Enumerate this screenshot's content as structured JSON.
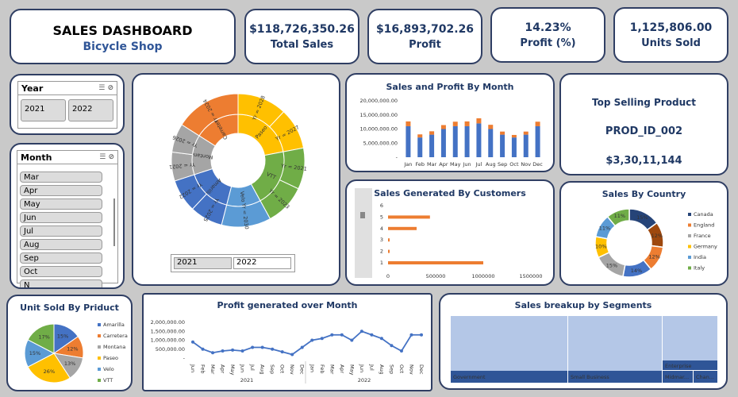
{
  "header": {
    "title": "SALES DASHBOARD",
    "subtitle": "Bicycle Shop"
  },
  "kpis": [
    {
      "value": "$118,726,350.26",
      "label": "Total Sales"
    },
    {
      "value": "$16,893,702.26",
      "label": "Profit"
    },
    {
      "value": "14.23%",
      "label": "Profit (%)"
    },
    {
      "value": "1,125,806.00",
      "label": "Units Sold"
    }
  ],
  "year_slicer": {
    "title": "Year",
    "items": [
      "2021",
      "2022"
    ]
  },
  "month_slicer": {
    "title": "Month",
    "items": [
      "Mar",
      "Apr",
      "May",
      "Jun",
      "Jul",
      "Aug",
      "Sep",
      "Oct",
      "N"
    ]
  },
  "top_product": {
    "title": "Top Selling Product",
    "product": "PROD_ID_002",
    "amount": "$3,30,11,144"
  },
  "sunburst": {
    "year_filter": [
      "2021",
      "2022"
    ],
    "inner": [
      "Paseo",
      "VTT",
      "Velo",
      "Amarilla",
      "Montana",
      "Carretera"
    ],
    "outer": [
      "Yr = 2028",
      "Yr = 2027",
      "Yr = 2021",
      "Yr = 2023",
      "Yr = 2030",
      "Yr = 2025",
      "Yr = 2022",
      "Yr = 2021",
      "Yr = 2026",
      "Yr = 2024"
    ]
  },
  "colors": {
    "blue": "#4472c4",
    "orange": "#ed7d31",
    "gray": "#a5a5a5",
    "yellow": "#ffc000",
    "lightblue": "#5b9bd5",
    "green": "#70ad47",
    "darkblue": "#264478",
    "brown": "#9e480e",
    "navy": "#2f3e63"
  },
  "chart_data": [
    {
      "id": "sales_profit_month",
      "type": "bar",
      "title": "Sales and Profit By Month",
      "categories": [
        "Jan",
        "Feb",
        "Mar",
        "Apr",
        "May",
        "Jun",
        "Jul",
        "Aug",
        "Sep",
        "Oct",
        "Nov",
        "Dec"
      ],
      "series": [
        {
          "values": [
            11000000,
            7000000,
            8000000,
            10000000,
            11000000,
            11000000,
            12000000,
            10000000,
            8000000,
            7000000,
            8000000,
            11000000
          ]
        },
        {
          "values": [
            1700000,
            1100000,
            1200000,
            1400000,
            1600000,
            1700000,
            1800000,
            1500000,
            1100000,
            900000,
            1100000,
            1600000
          ]
        }
      ],
      "yticks": [
        "20,000,000.00",
        "15,000,000.00",
        "10,000,000.00",
        "5,000,000.00",
        "-"
      ],
      "ylim": [
        0,
        20000000
      ]
    },
    {
      "id": "sales_by_customers",
      "type": "bar",
      "title": "Sales Generated By Customers",
      "categories": [
        "1",
        "2",
        "3",
        "4",
        "5",
        "6"
      ],
      "values": [
        1000000,
        5000,
        10000,
        300000,
        440000,
        0
      ],
      "xticks": [
        "0",
        "500000",
        "1000000",
        "1500000"
      ],
      "xlim": [
        0,
        1500000
      ]
    },
    {
      "id": "sales_by_country",
      "type": "pie",
      "title": "Sales By Country",
      "labels": [
        "Canada",
        "England",
        "France",
        "Germany",
        "India",
        "Italy"
      ],
      "slices": [
        {
          "label": "15%",
          "value": 15
        },
        {
          "label": "12%",
          "value": 12
        },
        {
          "label": "12%",
          "value": 12
        },
        {
          "label": "14%",
          "value": 14
        },
        {
          "label": "15%",
          "value": 15
        },
        {
          "label": "10%",
          "value": 10
        },
        {
          "label": "11%",
          "value": 11
        },
        {
          "label": "11%",
          "value": 11
        }
      ]
    },
    {
      "id": "units_by_product",
      "type": "pie",
      "title": "Unit Sold By Priduct",
      "labels": [
        "Amarilla",
        "Carretera",
        "Montana",
        "Paseo",
        "Velo",
        "VTT"
      ],
      "values": [
        15,
        12,
        13,
        26,
        15,
        17
      ]
    },
    {
      "id": "profit_over_month",
      "type": "line",
      "title": "Profit generated over Month",
      "x": [
        "Jun",
        "Feb",
        "Mar",
        "Apr",
        "May",
        "Jun",
        "Jul",
        "Aug",
        "Sep",
        "Oct",
        "Nov",
        "Dec",
        "Jan",
        "Feb",
        "Mar",
        "Apr",
        "May",
        "Jun",
        "Jul",
        "Aug",
        "Sep",
        "Oct",
        "Nov",
        "Dec"
      ],
      "groups": [
        "2021",
        "2022"
      ],
      "values": [
        900000,
        500000,
        300000,
        400000,
        450000,
        400000,
        600000,
        600000,
        500000,
        350000,
        200000,
        600000,
        1000000,
        1100000,
        1300000,
        1300000,
        1000000,
        1500000,
        1300000,
        1100000,
        700000,
        400000,
        1300000,
        1300000
      ],
      "yticks": [
        "2,000,000.00",
        "1,500,000.00",
        "1,000,000.00",
        "500,000.00",
        "-"
      ],
      "ylim": [
        0,
        2000000
      ]
    },
    {
      "id": "sales_by_segment",
      "type": "heatmap",
      "title": "Sales breakup by Segments",
      "labels": [
        "Government",
        "Small Business",
        "Enterprise",
        "Midmar...",
        "Chan..."
      ],
      "values": [
        52,
        42,
        6,
        0,
        0
      ]
    }
  ]
}
